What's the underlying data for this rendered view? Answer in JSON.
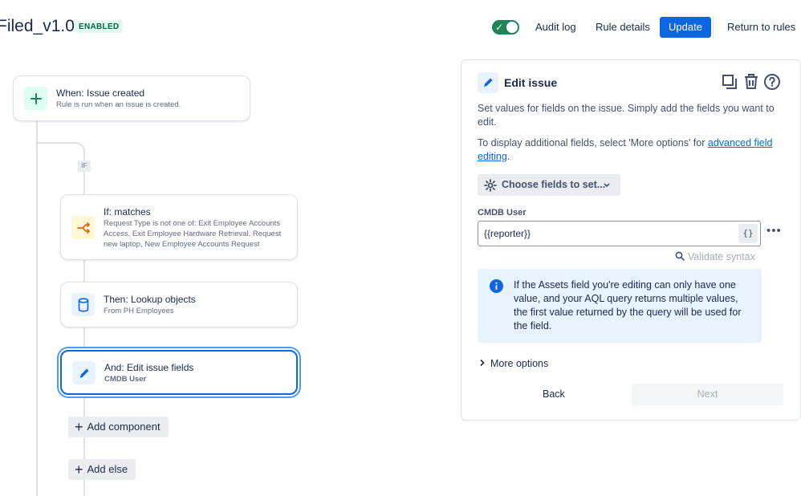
{
  "header": {
    "rule_title": "Filed_v1.0",
    "status_badge": "ENABLED",
    "toggle_on": true,
    "audit_log": "Audit log",
    "rule_details": "Rule details",
    "update": "Update",
    "return_to_rules": "Return to rules"
  },
  "flow": {
    "if_tag": "IF",
    "trigger": {
      "title": "When: Issue created",
      "subtitle": "Rule is run when an issue is created.",
      "icon": "plus-icon"
    },
    "condition": {
      "title": "If: matches",
      "subtitle_lines": [
        "Request Type is not one of: Exit Employee Accounts",
        "Access, Exit Employee Hardware Retrieval, Request",
        "new laptop, New Employee Accounts Request"
      ],
      "icon": "branch-icon"
    },
    "lookup": {
      "title": "Then: Lookup objects",
      "subtitle": "From PH Employees",
      "icon": "database-icon"
    },
    "edit": {
      "title": "And: Edit issue fields",
      "subtitle": "CMDB User",
      "icon": "pencil-icon"
    },
    "add_component": "Add component",
    "add_else": "Add else"
  },
  "panel": {
    "title": "Edit issue",
    "desc1": "Set values for fields on the issue. Simply add the fields you want to edit.",
    "desc2_prefix": "To display additional fields, select 'More options' for ",
    "desc2_link": "advanced field editing",
    "desc2_suffix": ".",
    "choose_fields": "Choose fields to set...",
    "field_label": "CMDB User",
    "field_value": "{{reporter}}",
    "braces": "{}",
    "validate": "Validate syntax",
    "info": "If the Assets field you're editing can only have one value, and your AQL query returns multiple values, the first value returned by the query will be used for the field.",
    "more_options": "More options",
    "back": "Back",
    "next": "Next"
  },
  "colors": {
    "primary": "#0c66e4",
    "toggle": "#1f845a",
    "badge_bg": "#e3fcef",
    "info_bg": "#e9f2ff"
  }
}
